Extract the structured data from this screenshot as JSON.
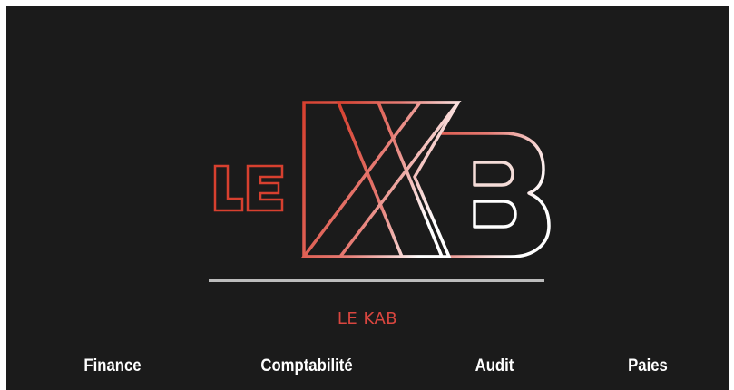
{
  "logo": {
    "wordmark": "LE XB",
    "gradient_start": "#d9453a",
    "gradient_end": "#ffffff"
  },
  "brand": {
    "name": "LE KAB",
    "color": "#d9463f"
  },
  "services": [
    {
      "label": "Finance"
    },
    {
      "label": "Comptabilité"
    },
    {
      "label": "Audit"
    },
    {
      "label": "Paies"
    }
  ],
  "colors": {
    "background": "#1b1b1b",
    "divider": "#bcbcbc",
    "text": "#ffffff"
  }
}
